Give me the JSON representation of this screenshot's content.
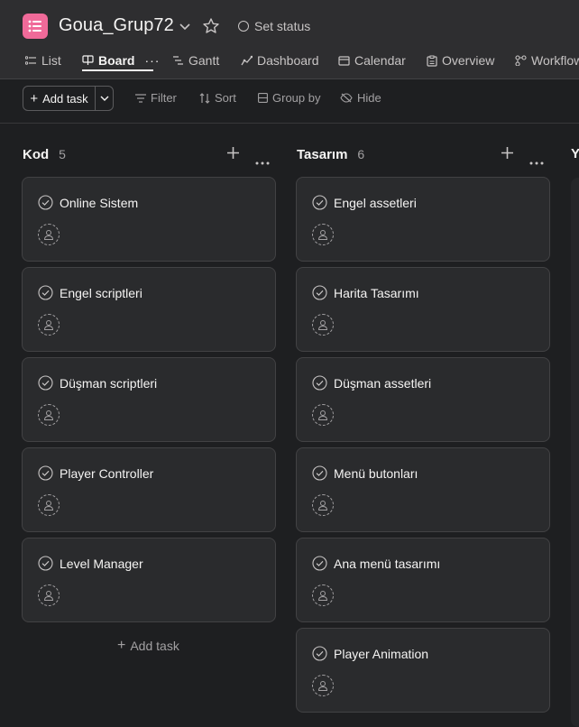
{
  "project": {
    "title": "Goua_Grup72",
    "set_status_label": "Set status",
    "icon_color": "#f06a99"
  },
  "tabs": [
    {
      "label": "List",
      "icon": "list-icon"
    },
    {
      "label": "Board",
      "icon": "board-icon",
      "active": true
    },
    {
      "label": "Gantt",
      "icon": "gantt-icon"
    },
    {
      "label": "Dashboard",
      "icon": "dashboard-icon"
    },
    {
      "label": "Calendar",
      "icon": "calendar-icon"
    },
    {
      "label": "Overview",
      "icon": "overview-icon"
    },
    {
      "label": "Workflow",
      "icon": "workflow-icon"
    }
  ],
  "toolbar": {
    "add_task_label": "Add task",
    "filter_label": "Filter",
    "sort_label": "Sort",
    "group_by_label": "Group by",
    "hide_label": "Hide"
  },
  "columns": [
    {
      "name": "Kod",
      "count": "5",
      "cards": [
        "Online Sistem",
        "Engel scriptleri",
        "Düşman scriptleri",
        "Player Controller",
        "Level Manager"
      ],
      "add_task_label": "Add task"
    },
    {
      "name": "Tasarım",
      "count": "6",
      "cards": [
        "Engel assetleri",
        "Harita Tasarımı",
        "Düşman assetleri",
        "Menü butonları",
        "Ana menü tasarımı",
        "Player Animation"
      ]
    },
    {
      "name": "Ya"
    }
  ]
}
